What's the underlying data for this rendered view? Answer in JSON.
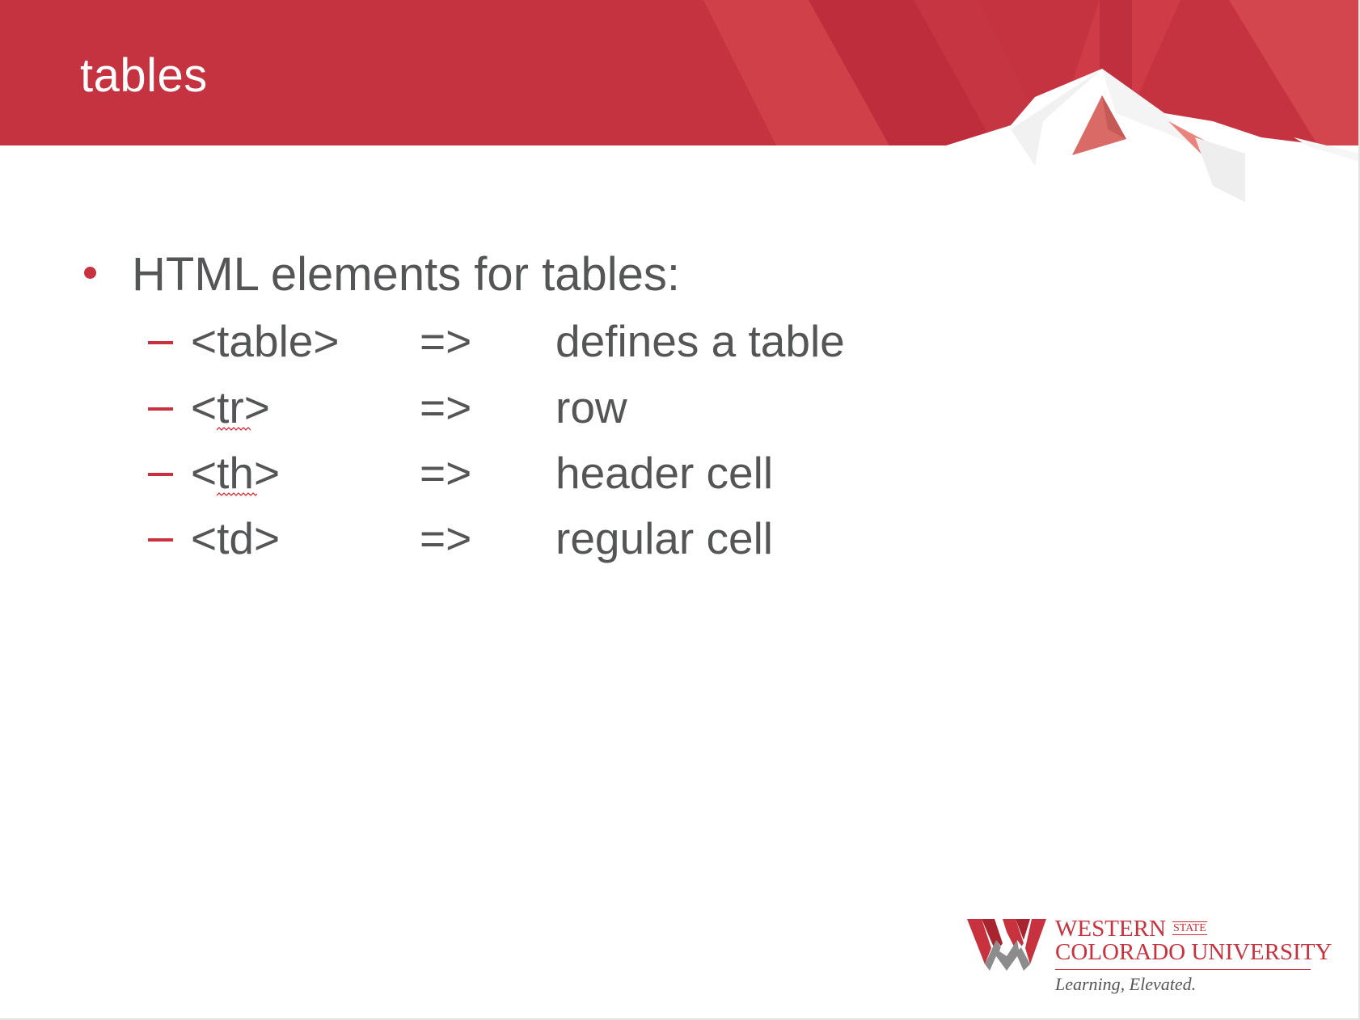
{
  "slide": {
    "title": "tables",
    "bullet": "HTML elements for tables:",
    "items": [
      {
        "tag": "<table>",
        "arrow": "=>",
        "description": "defines a table",
        "spell_flag": false
      },
      {
        "tag": "<tr>",
        "arrow": "=>",
        "description": "row",
        "spell_flag": true
      },
      {
        "tag": "<th>",
        "arrow": "=>",
        "description": "header cell",
        "spell_flag": true
      },
      {
        "tag": "<td>",
        "arrow": "=>",
        "description": "regular cell",
        "spell_flag": false
      }
    ]
  },
  "logo": {
    "line1": "WESTERN",
    "line1_small": "STATE",
    "line2": "COLORADO UNIVERSITY",
    "tagline": "Learning, Elevated."
  },
  "colors": {
    "brand_red": "#c8323f",
    "banner_red": "#c63340",
    "text_gray": "#545556",
    "background": "#ffffff"
  }
}
